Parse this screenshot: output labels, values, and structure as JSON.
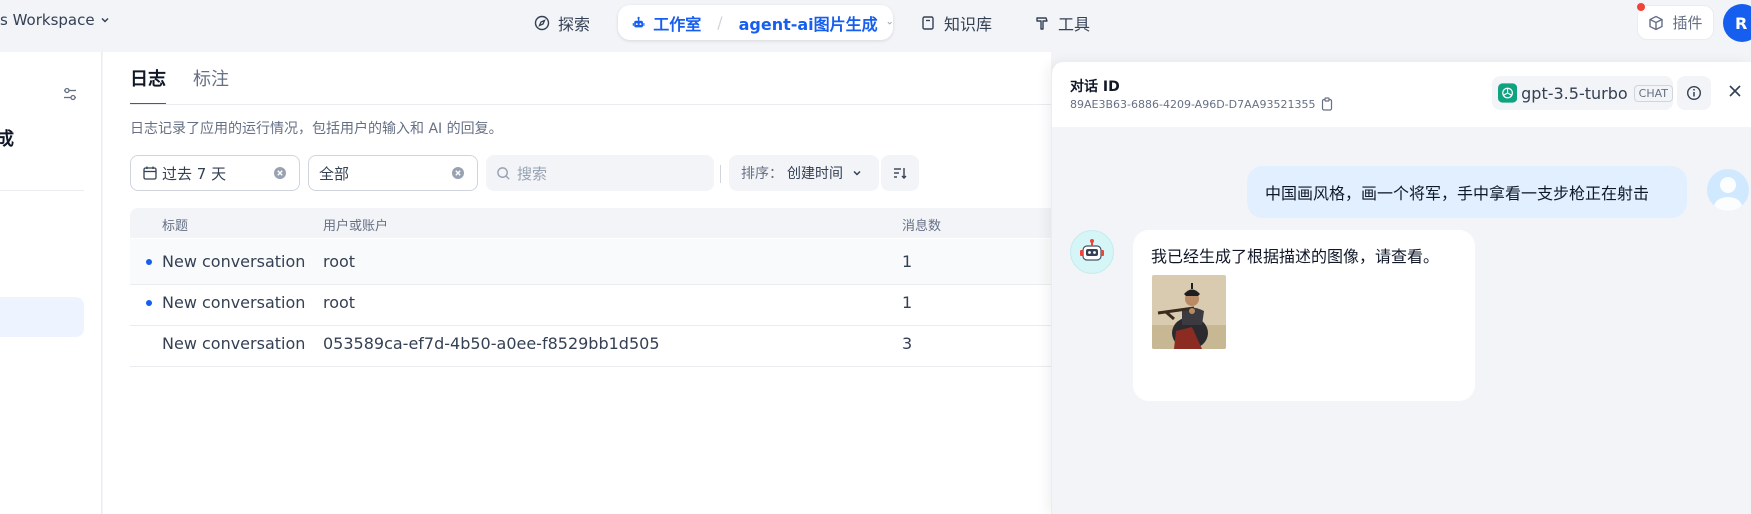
{
  "topbar": {
    "workspace": "s Workspace",
    "nav": {
      "explore": "探索",
      "studio": "工作室",
      "app_name": "agent-ai图片生成",
      "knowledge": "知识库",
      "tools": "工具"
    },
    "plugin": "插件",
    "avatar_letter": "R"
  },
  "sidebar": {
    "title_fragment": "成"
  },
  "main": {
    "tabs": [
      "日志",
      "标注"
    ],
    "description": "日志记录了应用的运行情况，包括用户的输入和 AI 的回复。",
    "filters": {
      "date": "过去 7 天",
      "status": "全部",
      "search_placeholder": "搜索",
      "sort_label": "排序：",
      "sort_value": "创建时间"
    },
    "table": {
      "headers": [
        "标题",
        "用户或账户",
        "消息数"
      ],
      "rows": [
        {
          "title": "New conversation",
          "user": "root",
          "count": "1",
          "unread": true
        },
        {
          "title": "New conversation",
          "user": "root",
          "count": "1",
          "unread": true
        },
        {
          "title": "New conversation",
          "user": "053589ca-ef7d-4b50-a0ee-f8529bb1d505",
          "count": "3",
          "unread": false
        }
      ]
    }
  },
  "drawer": {
    "title": "对话 ID",
    "conversation_id": "89AE3B63-6886-4209-A96D-D7AA93521355",
    "model": "gpt-3.5-turbo",
    "model_badge": "CHAT",
    "messages": {
      "user": "中国画风格，画一个将军，手中拿看一支步枪正在射击",
      "bot": "我已经生成了根据描述的图像，请查看。"
    }
  },
  "colors": {
    "accent": "#155eef",
    "background": "#f2f4f7",
    "user_bubble": "#e1effe"
  }
}
